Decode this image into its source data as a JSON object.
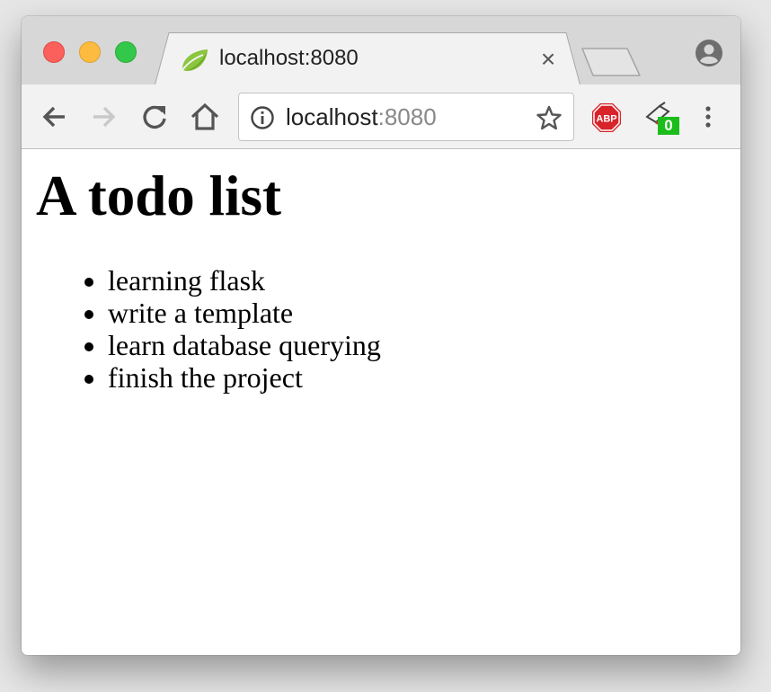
{
  "tab": {
    "title": "localhost:8080",
    "close_glyph": "×",
    "favicon": "spring-leaf-icon"
  },
  "omnibox": {
    "host": "localhost",
    "port": ":8080"
  },
  "extensions": {
    "abp_label": "ABP",
    "badge_count": "0"
  },
  "page": {
    "title": "A todo list",
    "items": [
      "learning flask",
      "write a template",
      "learn database querying",
      "finish the project"
    ]
  },
  "colors": {
    "close": "#fc605c",
    "minimize": "#fdbc40",
    "maximize": "#34c84a",
    "abp_red": "#d8232a",
    "badge_green": "#1bbd1b"
  }
}
